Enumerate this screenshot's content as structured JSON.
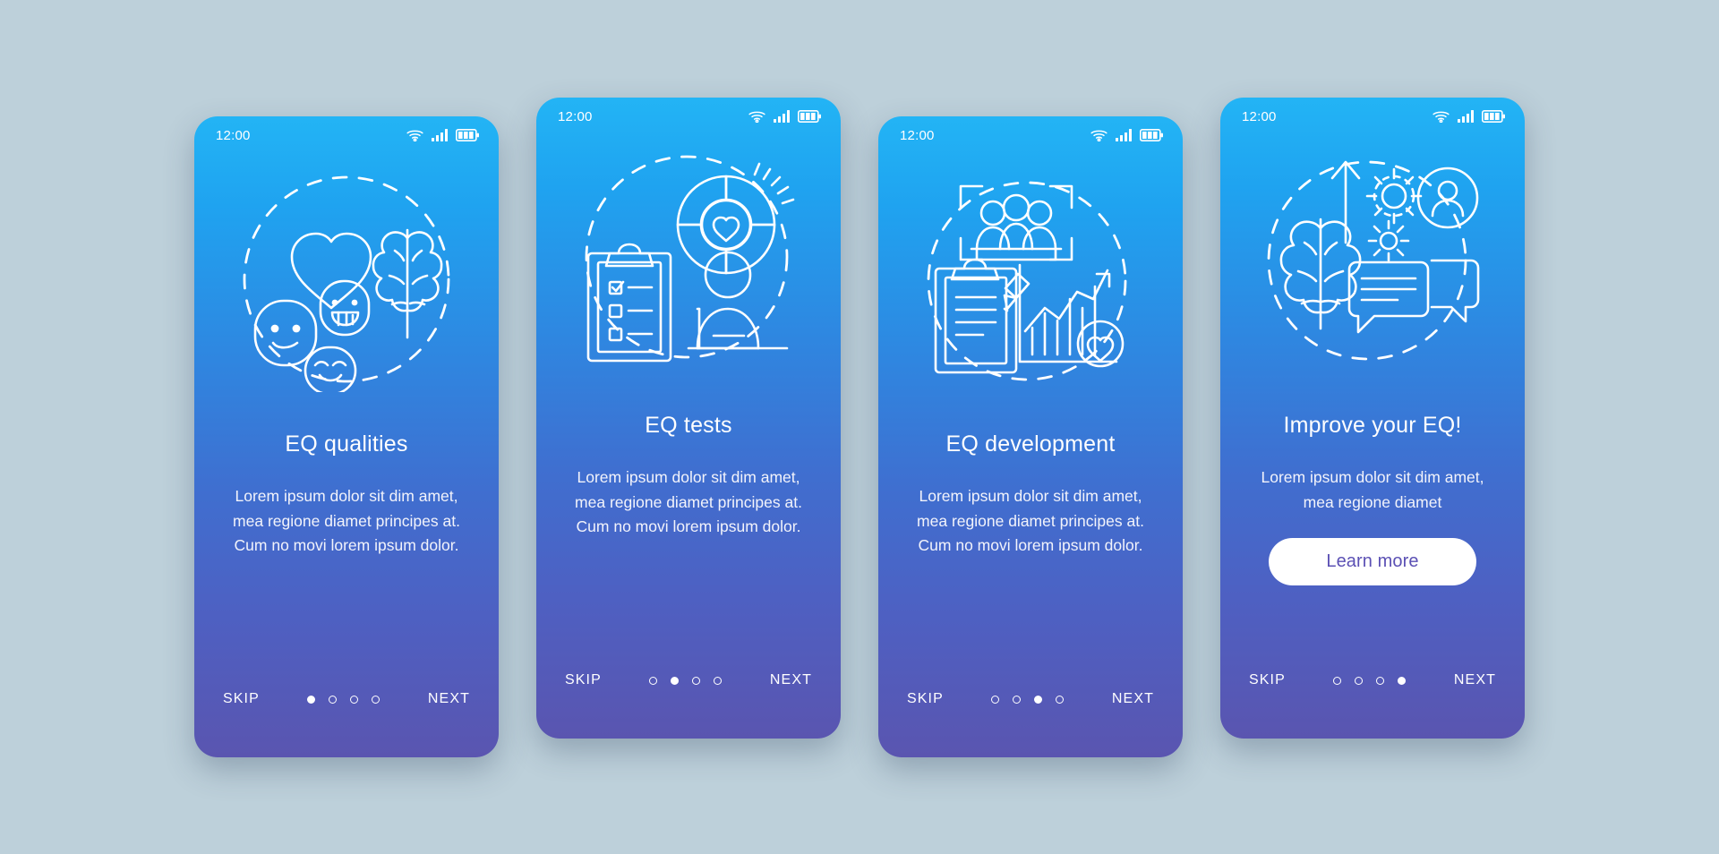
{
  "background_color": "#bdd0da",
  "theme": {
    "gradient_top": "#23b4f5",
    "gradient_bottom": "#5a55b0",
    "text_color": "#ffffff",
    "cta_bg": "#ffffff",
    "cta_text_color": "#5b50b4"
  },
  "statusbar": {
    "time": "12:00",
    "icons": [
      "wifi-icon",
      "signal-bars-icon",
      "battery-icon"
    ]
  },
  "nav": {
    "skip_label": "SKIP",
    "next_label": "NEXT",
    "dot_count": 4
  },
  "screens": [
    {
      "id": "eq-qualities",
      "illustration": "heart-brain-smileys-icon",
      "title": "EQ qualities",
      "body": "Lorem ipsum dolor sit dim amet, mea regione diamet principes at. Cum no movi lorem ipsum dolor.",
      "active_dot": 1,
      "has_cta": false,
      "cta_label": ""
    },
    {
      "id": "eq-tests",
      "illustration": "clipboard-chart-person-icon",
      "title": "EQ tests",
      "body": "Lorem ipsum dolor sit dim amet, mea regione diamet principes at. Cum no movi lorem ipsum dolor.",
      "active_dot": 2,
      "has_cta": false,
      "cta_label": ""
    },
    {
      "id": "eq-development",
      "illustration": "team-clipboard-growth-icon",
      "title": "EQ development",
      "body": "Lorem ipsum dolor sit dim amet, mea regione diamet principes at. Cum no movi lorem ipsum dolor.",
      "active_dot": 3,
      "has_cta": false,
      "cta_label": ""
    },
    {
      "id": "improve-your-eq",
      "illustration": "brain-gears-chat-icon",
      "title": "Improve your EQ!",
      "body": "Lorem ipsum dolor sit dim amet, mea regione diamet",
      "active_dot": 4,
      "has_cta": true,
      "cta_label": "Learn more"
    }
  ]
}
